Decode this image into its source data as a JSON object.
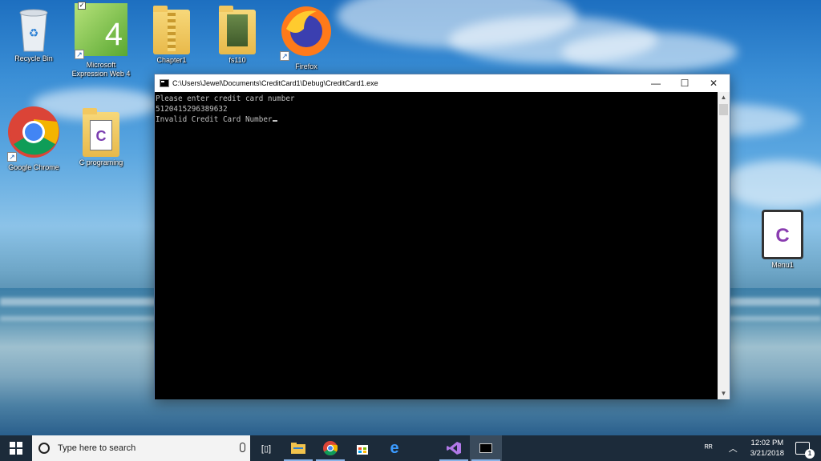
{
  "desktop": {
    "icons": [
      {
        "label": "Recycle Bin"
      },
      {
        "label": "Microsoft Expression Web 4"
      },
      {
        "label": "Chapter1"
      },
      {
        "label": "fs110"
      },
      {
        "label": "Firefox"
      },
      {
        "label": "Google Chrome"
      },
      {
        "label": "C programing"
      },
      {
        "label": "Menu1"
      }
    ]
  },
  "window": {
    "title": "C:\\Users\\Jewel\\Documents\\CreditCard1\\Debug\\CreditCard1.exe",
    "minimize": "—",
    "maximize": "☐",
    "close": "✕",
    "console_lines": [
      "Please enter credit card number",
      "5120415296389632",
      "Invalid Credit Card Number"
    ]
  },
  "taskbar": {
    "search_placeholder": "Type here to search",
    "time": "12:02 PM",
    "date": "3/21/2018",
    "notification_count": "1"
  }
}
